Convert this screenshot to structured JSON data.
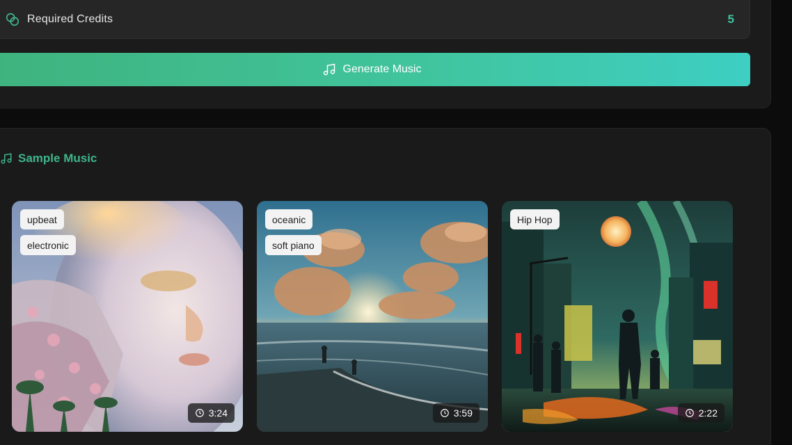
{
  "credits": {
    "label": "Required Credits",
    "value": "5",
    "icon": "coins-icon"
  },
  "generate": {
    "label": "Generate Music",
    "icon": "music-note-icon"
  },
  "samples": {
    "title": "Sample Music",
    "icon": "music-note-icon",
    "items": [
      {
        "tags": [
          "upbeat",
          "electronic"
        ],
        "duration": "3:24",
        "art": "surreal-face-city"
      },
      {
        "tags": [
          "oceanic",
          "soft piano"
        ],
        "duration": "3:59",
        "art": "beach-sunset"
      },
      {
        "tags": [
          "Hip Hop"
        ],
        "duration": "2:22",
        "art": "neon-city-night"
      }
    ]
  },
  "colors": {
    "accent": "#3fb58a",
    "button_start": "#3fb37e",
    "button_end": "#3ecfc3"
  }
}
